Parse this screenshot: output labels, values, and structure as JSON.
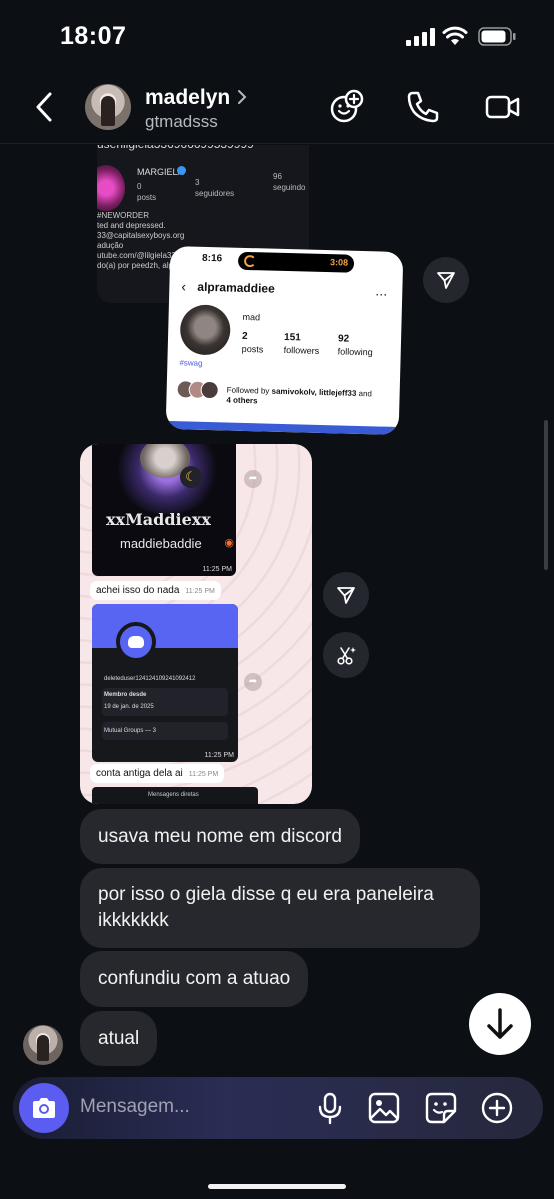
{
  "status_bar": {
    "time": "18:07"
  },
  "header": {
    "name": "madelyn",
    "handle": "gtmadsss"
  },
  "shared_dark_profile": {
    "username": "userlilgiela336966699539999",
    "name": "MARGIELA",
    "posts_count": "0",
    "posts_label": "posts",
    "followers_count": "3",
    "followers_label": "seguidores",
    "following_count": "96",
    "following_label": "seguindo",
    "bio_lines": [
      "#NEWORDER",
      "ted and depressed.",
      "33@capitalsexyboys.org",
      "adução",
      "utube.com/@lilgiela33",
      "do(a) por peedzh, alpra"
    ]
  },
  "shared_profile_card": {
    "phone_time": "8:16",
    "timer": "3:08",
    "username": "alpramaddiee",
    "display_name": "mad",
    "posts_count": "2",
    "posts_label": "posts",
    "followers_count": "151",
    "followers_label": "followers",
    "following_count": "92",
    "following_label": "following",
    "hashtag": "#swag",
    "followed_by_prefix": "Followed by ",
    "followed_by_names": "samivokolv, littlejeff33",
    "followed_by_suffix": " and",
    "followed_by_others": "4 others"
  },
  "whatsapp_card": {
    "image1_title": "xxMaddiexx",
    "image1_subtitle": "maddiebaddie",
    "image1_time": "11:25 PM",
    "message1": "achei isso do nada",
    "message1_time": "11:25 PM",
    "discord_user": "deleteduser12412410924109241​2",
    "discord_member_since_label": "Membro desde",
    "discord_member_since": "19 de jan. de 2025",
    "discord_mutual": "Mutual Groups — 3",
    "image2_time": "11:25 PM",
    "message2": "conta antiga dela ai",
    "message2_time": "11:25 PM",
    "image3_label": "Mensagens diretas"
  },
  "messages": [
    {
      "text": "usava meu nome em discord"
    },
    {
      "text_line1": "por isso o giela disse q eu era paneleira",
      "text_line2": "ikkkkkkk"
    },
    {
      "text": "confundiu com a atuao"
    },
    {
      "text": "atual"
    }
  ],
  "composer": {
    "placeholder": "Mensagem..."
  },
  "colors": {
    "background": "#0c0f14",
    "bubble": "#26282e",
    "camera_button": "#5b5cf0",
    "accent_blue": "#3a5bd6"
  }
}
